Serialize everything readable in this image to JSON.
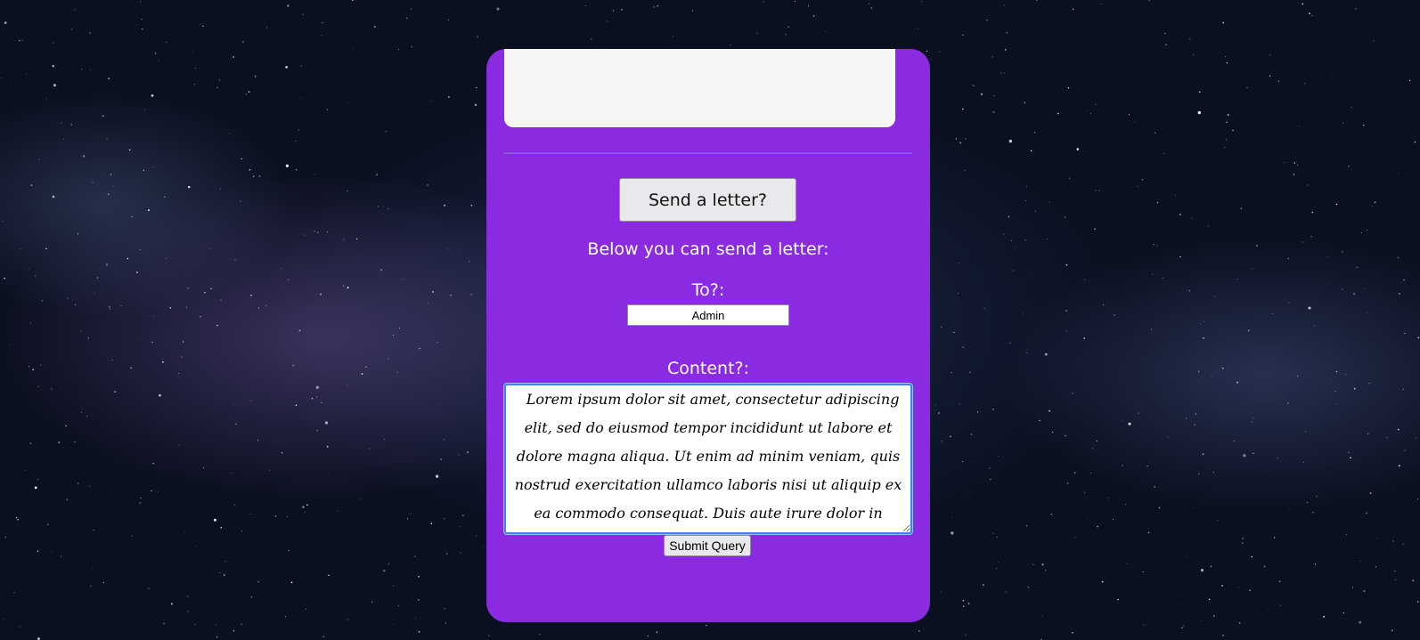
{
  "colors": {
    "card_background": "#8a2be2",
    "text_on_card": "#ffffff",
    "button_background": "#e9e9ed",
    "focus_ring": "#3b82f6"
  },
  "letter_section": {
    "send_button_label": "Send a letter?",
    "intro_text": "Below you can send a letter:"
  },
  "form": {
    "to_label": "To?:",
    "to_value": "Admin",
    "content_label": "Content?:",
    "content_value": "  Lorem ipsum dolor sit amet, consectetur adipiscing elit, sed do eiusmod tempor incididunt ut labore et dolore magna aliqua. Ut enim ad minim veniam, quis nostrud exercitation ullamco laboris nisi ut aliquip ex ea commodo consequat. Duis aute irure dolor in reprehenderit in voluptate velit esse cillum dolore",
    "submit_label": "Submit Query"
  }
}
